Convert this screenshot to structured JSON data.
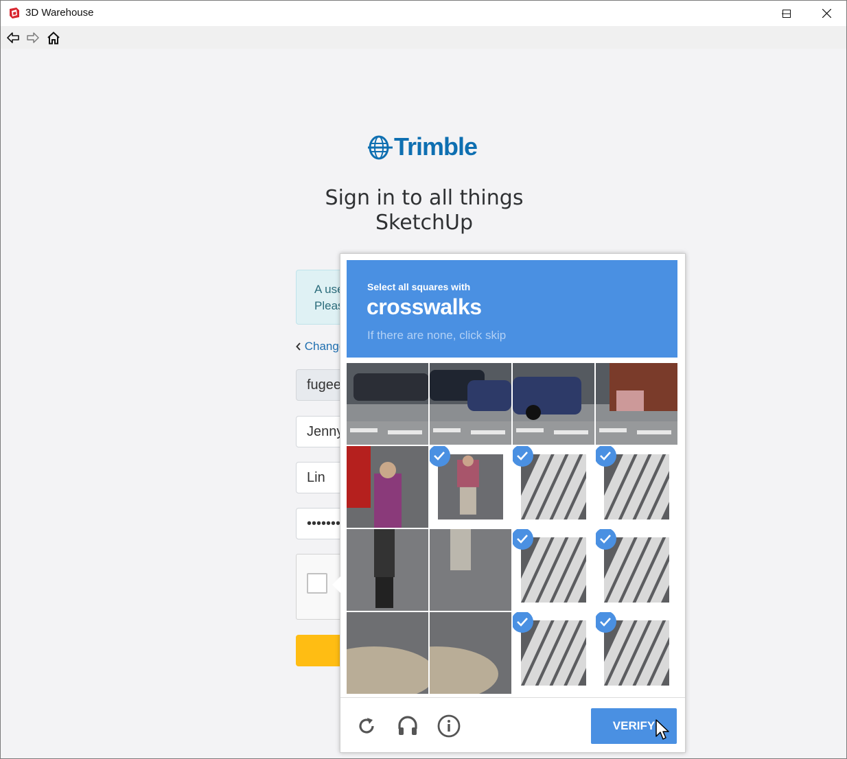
{
  "window": {
    "title": "3D Warehouse",
    "controls": [
      "minimize",
      "maximize",
      "close"
    ]
  },
  "toolbar": {
    "buttons": [
      "back-arrow-icon",
      "forward-arrow-icon",
      "home-icon"
    ]
  },
  "logo": {
    "text": "Trimble"
  },
  "heading": {
    "line1": "Sign in to all things",
    "line2": "SketchUp"
  },
  "alert": {
    "line1": "A use",
    "line2": "Pleas"
  },
  "change_link": "Change",
  "form": {
    "email_value": "fugee",
    "first_name_value": "Jenny",
    "last_name_value": "Lin",
    "password_value": "•••••••"
  },
  "challenge": {
    "instruction": "Select all squares with",
    "target": "crosswalks",
    "hint": "If there are none, click skip",
    "grid": {
      "rows": 4,
      "cols": 4,
      "selected": [
        false,
        false,
        false,
        false,
        false,
        true,
        true,
        true,
        false,
        false,
        true,
        true,
        false,
        false,
        true,
        true
      ]
    },
    "footer_icons": [
      "reload-icon",
      "audio-icon",
      "info-icon"
    ],
    "verify_label": "VERIFY"
  },
  "colors": {
    "accent_blue": "#4a90e2",
    "signin_yellow": "#ffbd13",
    "trimble_blue": "#0e6fb1"
  }
}
